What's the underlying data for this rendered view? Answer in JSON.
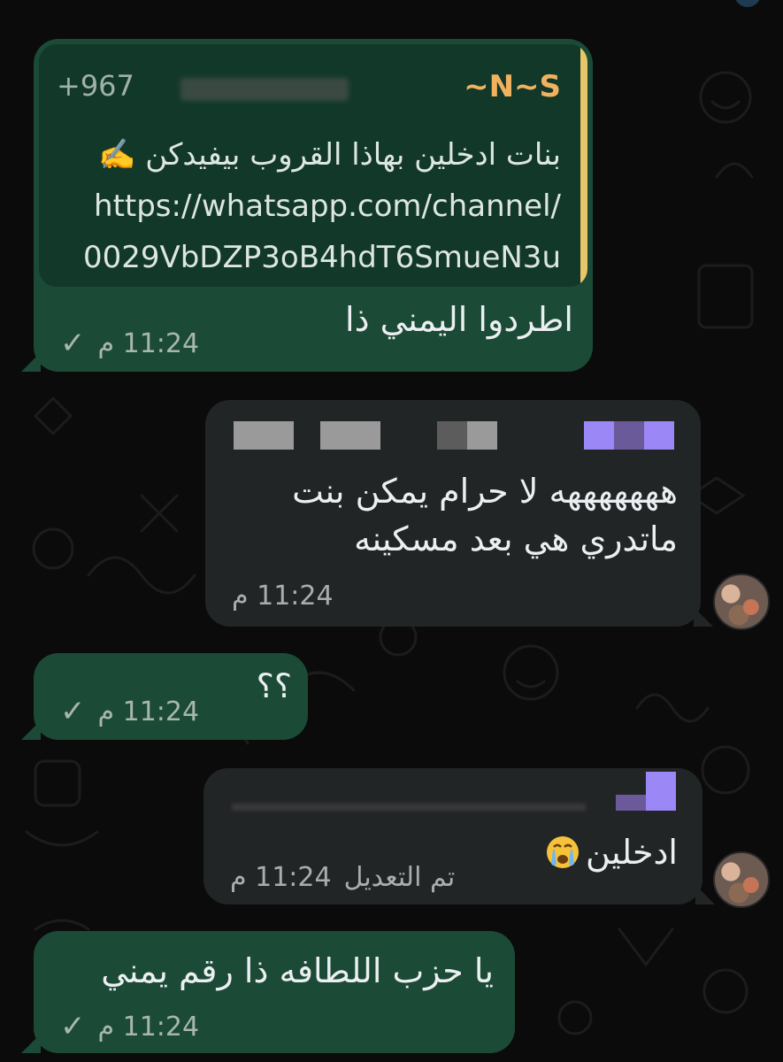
{
  "messages": [
    {
      "quote": {
        "sender": "~N~S",
        "phone": "+967",
        "text_line": "بنات ادخلين بهاذا القروب بيفيدكن ✍️",
        "link_1": "https://whatsapp.com/channel/",
        "link_2": "0029VbDZP3oB4hdT6SmueN3u"
      },
      "text": "اطردوا اليمني ذا",
      "time": "11:24 م",
      "status": "✓"
    },
    {
      "text": "هههههههه لا حرام يمكن بنت\nماتدري هي بعد مسكينه",
      "time": "11:24 م"
    },
    {
      "text": "؟؟",
      "time": "11:24 م",
      "status": "✓"
    },
    {
      "text": "ادخلين",
      "emoji": "crying-face",
      "edited_label": "تم التعديل",
      "time": "11:24 م"
    },
    {
      "text": "يا حزب اللطافه ذا رقم يمني",
      "time": "11:24 م",
      "status": "✓"
    }
  ],
  "colors": {
    "outgoing_bubble": "#1b4a36",
    "incoming_bubble": "#222526",
    "quote_name": "#f1b25f",
    "quote_bar": "#e8c76a",
    "sender_purple": "#9b87f5"
  }
}
